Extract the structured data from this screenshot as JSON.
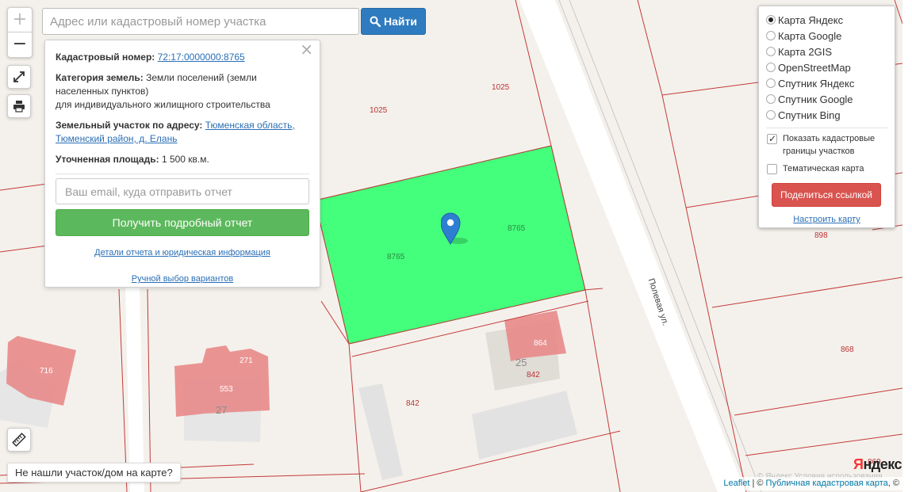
{
  "search": {
    "placeholder": "Адрес или кадастровый номер участка",
    "button_label": "Найти"
  },
  "zoom": {
    "in_label": "+",
    "out_label": "−"
  },
  "popup": {
    "cadastral_label": "Кадастровый номер:",
    "cadastral_number": "72:17:0000000:8765",
    "category_label": "Категория земель:",
    "category_value": "Земли поселений (земли населенных пунктов)",
    "usage_value": "для индивидуального жилищного строительства",
    "address_label": "Земельный участок по адресу:",
    "address_value": "Тюменская область, Тюменский район, д. Елань",
    "area_label": "Уточненная площадь:",
    "area_value": "1 500 кв.м.",
    "email_placeholder": "Ваш email, куда отправить отчет",
    "report_button": "Получить подробный отчет",
    "details_link": "Детали отчета и юридическая информация",
    "manual_link": "Ручной выбор вариантов",
    "close_glyph": "×"
  },
  "layers": {
    "options": [
      {
        "label": "Карта Яндекс",
        "selected": true
      },
      {
        "label": "Карта Google",
        "selected": false
      },
      {
        "label": "Карта 2GIS",
        "selected": false
      },
      {
        "label": "OpenStreetMap",
        "selected": false
      },
      {
        "label": "Спутник Яндекс",
        "selected": false
      },
      {
        "label": "Спутник Google",
        "selected": false
      },
      {
        "label": "Спутник Bing",
        "selected": false
      }
    ],
    "show_borders_label": "Показать кадастровые границы участков",
    "show_borders_checked": true,
    "thematic_label": "Тематическая карта",
    "thematic_checked": false,
    "share_button": "Поделиться ссылкой",
    "config_link": "Настроить карту"
  },
  "not_found_button": "Не нашли участок/дом на карте?",
  "attribution": {
    "leaflet": "Leaflet",
    "separator": " | © ",
    "pkk": "Публичная кадастровая карта",
    "suffix": ", ©"
  },
  "yandex_logo": {
    "first": "Я",
    "rest": "ндекс"
  },
  "faint_copyright": "© Яндекс Условия использования",
  "map": {
    "cadastral_labels": [
      "1025",
      "1025",
      "898",
      "868",
      "869",
      "842",
      "842",
      "8765",
      "8765"
    ],
    "building_labels": [
      "716",
      "271",
      "553",
      "864"
    ],
    "house_numbers": [
      "27",
      "25"
    ],
    "street_name": "Полевая ул.",
    "plot_color": "#44ff7c",
    "building_color": "#e8898a",
    "border_color": "#c43a3a",
    "marker_color": "#2e7fd1"
  },
  "icons": {
    "search": "search-icon",
    "fullscreen": "fullscreen-icon",
    "print": "print-icon",
    "ruler": "ruler-icon",
    "marker": "map-marker-icon"
  }
}
